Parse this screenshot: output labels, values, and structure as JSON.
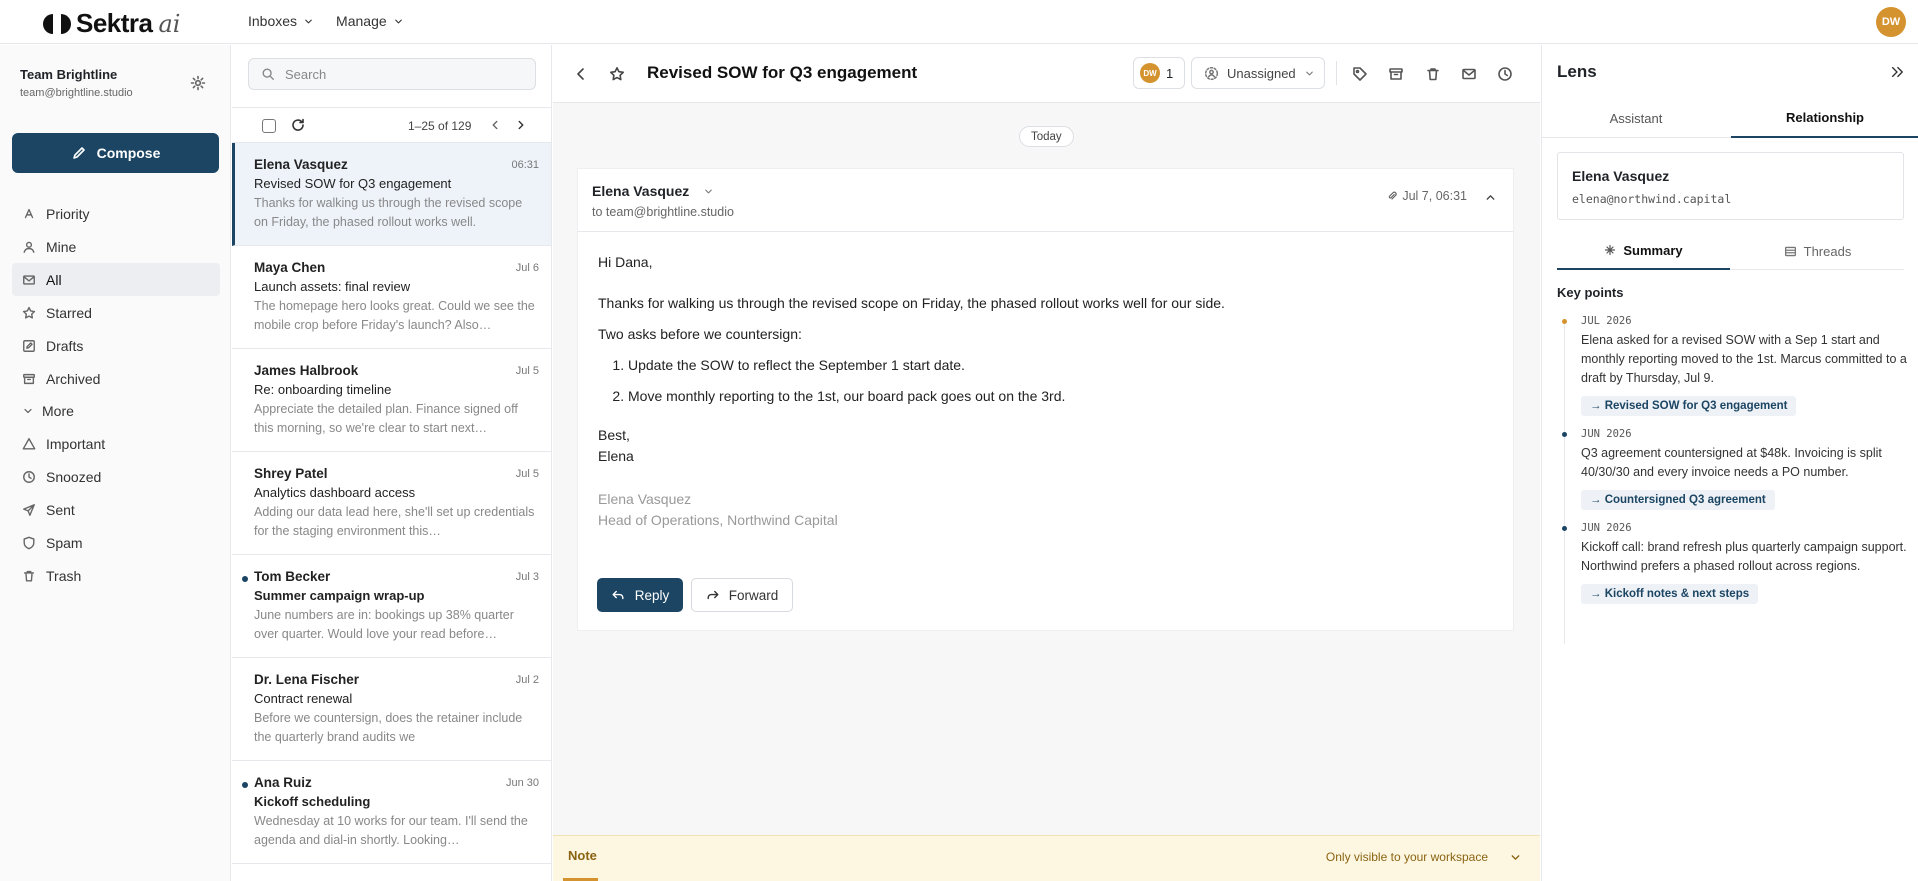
{
  "app": {
    "logo_text": "Sektra",
    "logo_suffix": "ai",
    "user_initials": "DW",
    "accent": "#1b4563",
    "user_color": "#d4932f"
  },
  "topnav": {
    "inboxes": "Inboxes",
    "manage": "Manage"
  },
  "sidebar": {
    "team_name": "Team Brightline",
    "team_email": "team@brightline.studio",
    "compose": "Compose",
    "items": [
      {
        "label": "Priority",
        "icon": "sort-icon"
      },
      {
        "label": "Mine",
        "icon": "user-icon"
      },
      {
        "label": "All",
        "icon": "mail-icon"
      },
      {
        "label": "Starred",
        "icon": "star-icon"
      },
      {
        "label": "Drafts",
        "icon": "pencil-icon"
      },
      {
        "label": "Archived",
        "icon": "archive-icon"
      }
    ],
    "more": "More",
    "more_items": [
      {
        "label": "Important",
        "icon": "warning-icon"
      },
      {
        "label": "Snoozed",
        "icon": "clock-icon"
      },
      {
        "label": "Sent",
        "icon": "send-icon"
      },
      {
        "label": "Spam",
        "icon": "shield-icon"
      },
      {
        "label": "Trash",
        "icon": "trash-icon"
      }
    ]
  },
  "list": {
    "search_placeholder": "Search",
    "pager": "1–25 of 129",
    "mails": [
      {
        "from": "Elena Vasquez",
        "date": "06:31",
        "subject": "Revised SOW for Q3 engagement",
        "snippet": "Thanks for walking us through the revised scope on Friday, the phased rollout works well."
      },
      {
        "from": "Maya Chen",
        "date": "Jul 6",
        "subject": "Launch assets: final review",
        "snippet": "The homepage hero looks great. Could we see the mobile crop before Friday's launch? Also…"
      },
      {
        "from": "James Halbrook",
        "date": "Jul 5",
        "subject": "Re: onboarding timeline",
        "snippet": "Appreciate the detailed plan. Finance signed off this morning, so we're clear to start next…"
      },
      {
        "from": "Shrey Patel",
        "date": "Jul 5",
        "subject": "Analytics dashboard access",
        "snippet": "Adding our data lead here, she'll set up credentials for the staging environment this…"
      },
      {
        "from": "Tom Becker",
        "date": "Jul 3",
        "subject": "Summer campaign wrap-up",
        "snippet": "June numbers are in: bookings up 38% quarter over quarter. Would love your read before…"
      },
      {
        "from": "Dr. Lena Fischer",
        "date": "Jul 2",
        "subject": "Contract renewal",
        "snippet": "Before we countersign, does the retainer include the quarterly brand audits we"
      },
      {
        "from": "Ana Ruiz",
        "date": "Jun 30",
        "subject": "Kickoff scheduling",
        "snippet": "Wednesday at 10 works for our team. I'll send the agenda and dial-in shortly. Looking…"
      }
    ]
  },
  "thread": {
    "title": "Revised SOW for Q3 engagement",
    "assignee_initials": "DW",
    "assignee_count": "1",
    "unassigned": "Unassigned",
    "day_divider": "Today",
    "from": "Elena Vasquez",
    "to": "to team@brightline.studio",
    "date": "Jul 7, 06:31",
    "greeting": "Hi Dana,",
    "para1": "Thanks for walking us through the revised scope on Friday, the phased rollout works well for our side.",
    "para2": "Two asks before we countersign:",
    "ask1": "Update the SOW to reflect the September 1 start date.",
    "ask2": "Move monthly reporting to the 1st, our board pack goes out on the 3rd.",
    "closing": "Best,",
    "sign_name": "Elena",
    "sig_name": "Elena Vasquez",
    "sig_title": "Head of Operations, Northwind Capital",
    "reply": "Reply",
    "forward": "Forward",
    "note_label": "Note",
    "note_visibility": "Only visible to your workspace"
  },
  "lens": {
    "title": "Lens",
    "tab_assistant": "Assistant",
    "tab_relationship": "Relationship",
    "contact_name": "Elena Vasquez",
    "contact_email": "elena@northwind.capital",
    "tab_summary": "Summary",
    "tab_threads": "Threads",
    "key_points": "Key points",
    "points": [
      {
        "date": "JUL 2026",
        "text": "Elena asked for a revised SOW with a Sep 1 start and monthly reporting moved to the 1st. Marcus committed to a draft by Thursday, Jul 9.",
        "link": "→ Revised SOW for Q3 engagement",
        "dot": "#d4932f"
      },
      {
        "date": "JUN 2026",
        "text": "Q3 agreement countersigned at $48k. Invoicing is split 40/30/30 and every invoice needs a PO number.",
        "link": "→ Countersigned Q3 agreement",
        "dot": "#1b4563"
      },
      {
        "date": "JUN 2026",
        "text": "Kickoff call: brand refresh plus quarterly campaign support. Northwind prefers a phased rollout across regions.",
        "link": "→ Kickoff notes & next steps",
        "dot": "#1b4563"
      }
    ]
  }
}
